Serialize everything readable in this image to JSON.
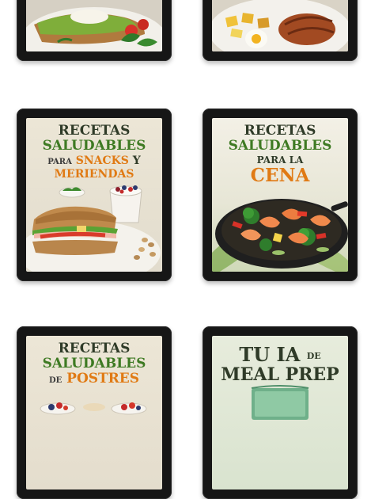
{
  "covers": [
    {
      "id": "desayunos-partial",
      "title_lines": []
    },
    {
      "id": "almuerzos-partial",
      "title_lines": []
    },
    {
      "id": "snacks",
      "line1": "RECETAS",
      "line2": "SALUDABLES",
      "line3_prefix": "PARA",
      "line3_highlight": "SNACKS",
      "line3_suffix": "Y",
      "line4": "MERIENDAS"
    },
    {
      "id": "cena",
      "line1": "RECETAS",
      "line2": "SALUDABLES",
      "line3": "PARA LA",
      "line4": "CENA"
    },
    {
      "id": "postres",
      "line1": "RECETAS",
      "line2": "SALUDABLES",
      "line3_prefix": "DE",
      "line3_highlight": "POSTRES"
    },
    {
      "id": "meal-prep",
      "line1_a": "TU IA",
      "line1_b": "DE",
      "line2": "MEAL PREP"
    }
  ],
  "colors": {
    "tablet_frame": "#161616",
    "title_dark": "#2f3b28",
    "title_green": "#3e7a23",
    "highlight_orange": "#e07a14"
  }
}
